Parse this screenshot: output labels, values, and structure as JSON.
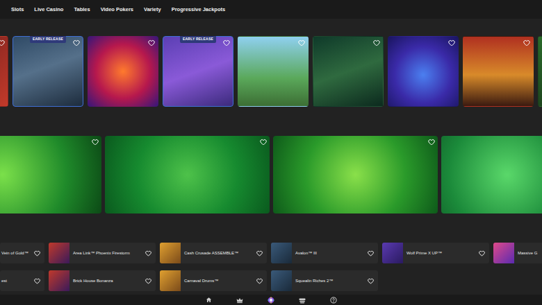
{
  "nav": [
    {
      "label": "Slots"
    },
    {
      "label": "Live Casino"
    },
    {
      "label": "Tables"
    },
    {
      "label": "Video Pokers"
    },
    {
      "label": "Variety"
    },
    {
      "label": "Progressive Jackpots"
    }
  ],
  "featured_tiles": [
    {
      "favorite": false
    },
    {
      "badge": "EARLY RELEASE",
      "favorite": false
    },
    {
      "favorite": false
    },
    {
      "badge": "EARLY RELEASE",
      "favorite": false
    },
    {
      "favorite": false
    },
    {
      "favorite": false
    },
    {
      "favorite": false
    },
    {
      "favorite": false
    },
    {
      "favorite": false
    }
  ],
  "reward_tiles": [
    {
      "favorite": false
    },
    {
      "favorite": false
    },
    {
      "favorite": false
    },
    {
      "favorite": false
    }
  ],
  "game_list": {
    "rows": [
      [
        {
          "name": "Vein of Gold™",
          "kind": "partial",
          "favorite": false
        },
        {
          "name": "Area Link™ Phoenix Firestorm",
          "kind": "full",
          "favorite": false
        },
        {
          "name": "Cash Crusade ASSEMBLE™",
          "kind": "full",
          "favorite": false
        },
        {
          "name": "Avalon™ III",
          "kind": "full",
          "favorite": false
        },
        {
          "name": "Wolf Prime X UP™",
          "kind": "full",
          "favorite": false
        },
        {
          "name": "Massive G",
          "kind": "full",
          "favorite": false
        }
      ],
      [
        {
          "name": "est",
          "kind": "partial",
          "favorite": false
        },
        {
          "name": "Brick House Bonanza",
          "kind": "full",
          "favorite": false
        },
        {
          "name": "Carnaval Drums™",
          "kind": "full",
          "favorite": false
        },
        {
          "name": "Squealin Riches 2™",
          "kind": "full",
          "favorite": false
        }
      ]
    ]
  },
  "bottom_nav": [
    {
      "selected": false
    },
    {
      "selected": false
    },
    {
      "selected": true
    },
    {
      "selected": false
    },
    {
      "selected": false
    }
  ]
}
